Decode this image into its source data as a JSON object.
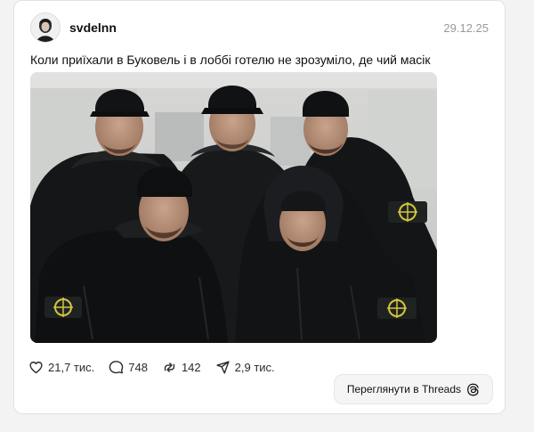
{
  "post": {
    "username": "svdelnn",
    "date": "29.12.25",
    "caption": "Коли приїхали в Буковель і в лоббі готелю не зрозуміло, де чий масік"
  },
  "media": {
    "icon": "photo-five-men-in-black-jackets"
  },
  "actions": {
    "likes": "21,7 тис.",
    "comments": "748",
    "reposts": "142",
    "shares": "2,9 тис."
  },
  "threads_button": {
    "label": "Переглянути в Threads",
    "icon": "threads-logo-icon"
  },
  "colors": {
    "card_bg": "#ffffff",
    "page_bg": "#f3f3f3",
    "text": "#101010",
    "muted": "#9a9a9a"
  }
}
